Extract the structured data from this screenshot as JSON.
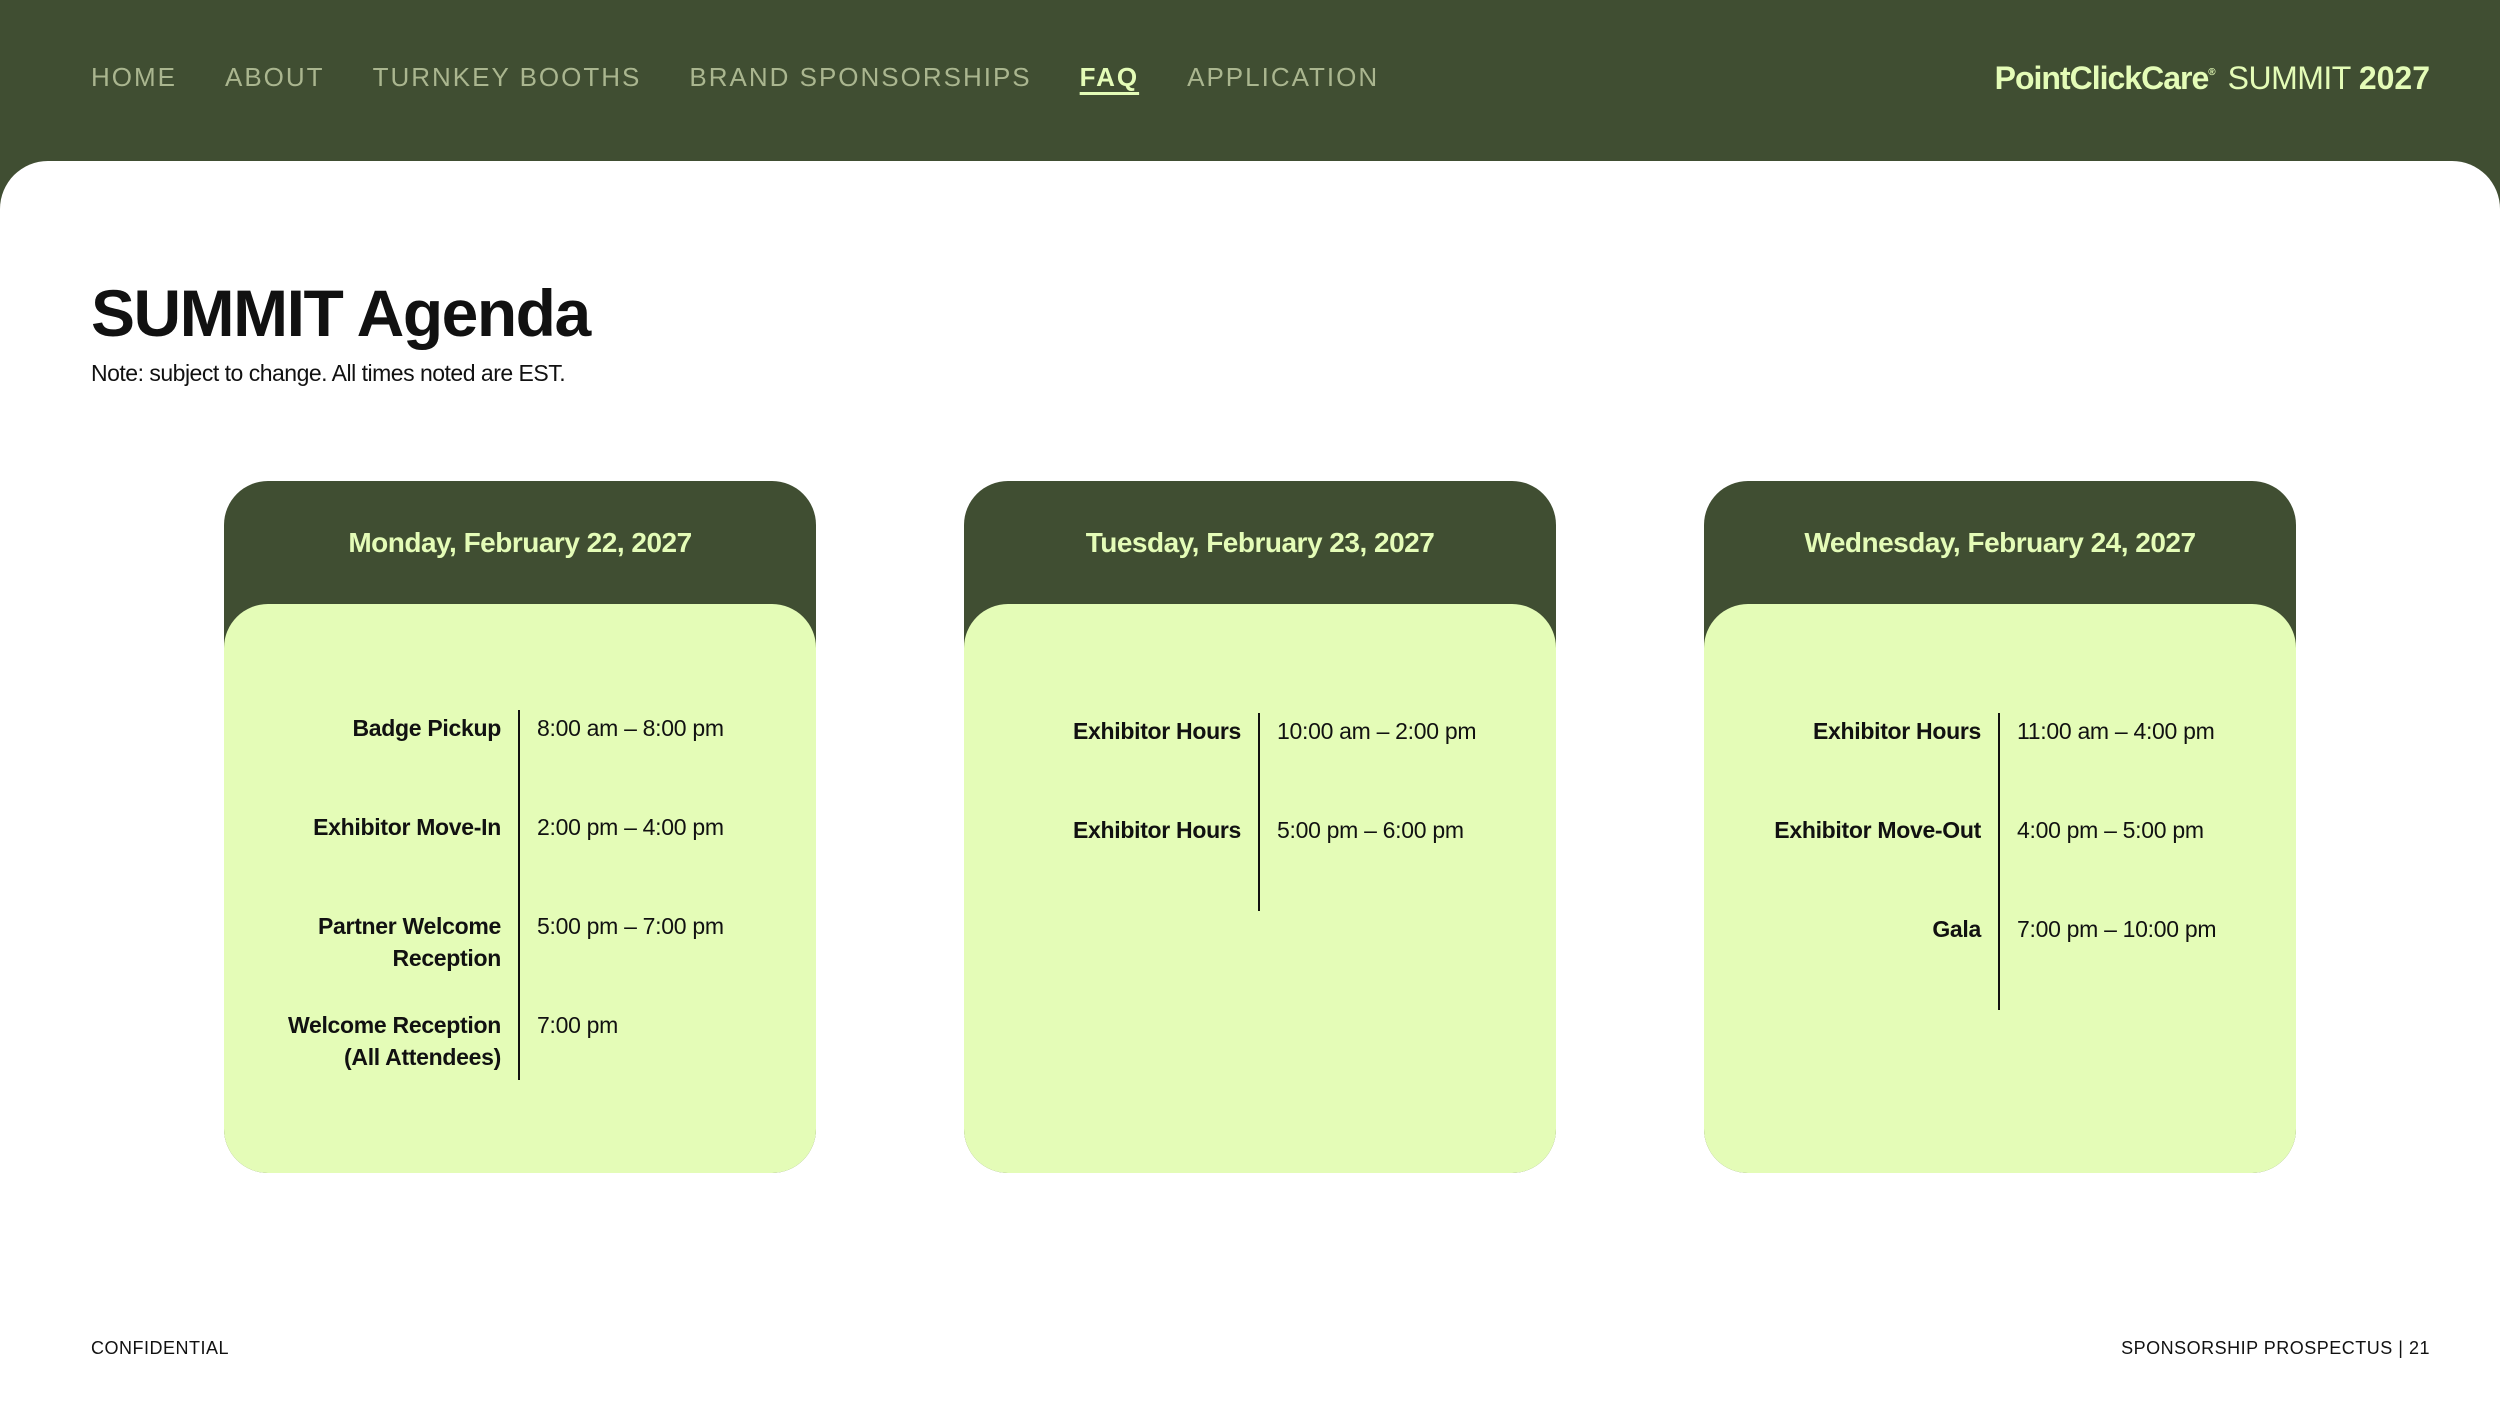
{
  "nav": {
    "items": [
      {
        "label": "HOME",
        "active": false
      },
      {
        "label": "ABOUT",
        "active": false
      },
      {
        "label": "TURNKEY BOOTHS",
        "active": false
      },
      {
        "label": "BRAND SPONSORSHIPS",
        "active": false
      },
      {
        "label": "FAQ",
        "active": true
      },
      {
        "label": "APPLICATION",
        "active": false
      }
    ]
  },
  "brand": {
    "name": "PointClickCare",
    "registered": "®",
    "event": "SUMMIT",
    "year": "2027"
  },
  "page": {
    "title": "SUMMIT Agenda",
    "note": "Note: subject to change. All times noted are EST."
  },
  "days": [
    {
      "date": "Monday, February 22, 2027",
      "rows": [
        {
          "label": "Badge Pickup",
          "time": "8:00 am – 8:00 pm"
        },
        {
          "label": "Exhibitor Move-In",
          "time": "2:00 pm – 4:00 pm"
        },
        {
          "label": "Partner Welcome Reception",
          "time": "5:00 pm – 7:00 pm"
        },
        {
          "label": "Welcome Reception (All Attendees)",
          "time": "7:00 pm"
        }
      ]
    },
    {
      "date": "Tuesday, February 23, 2027",
      "rows": [
        {
          "label": "Exhibitor Hours",
          "time": "10:00 am – 2:00 pm"
        },
        {
          "label": "Exhibitor Hours",
          "time": "5:00 pm – 6:00 pm"
        }
      ]
    },
    {
      "date": "Wednesday, February 24, 2027",
      "rows": [
        {
          "label": "Exhibitor Hours",
          "time": "11:00 am – 4:00 pm"
        },
        {
          "label": "Exhibitor Move-Out",
          "time": "4:00 pm – 5:00 pm"
        },
        {
          "label": "Gala",
          "time": "7:00 pm – 10:00 pm"
        }
      ]
    }
  ],
  "footer": {
    "left": "CONFIDENTIAL",
    "right": "SPONSORSHIP PROSPECTUS | 21"
  },
  "colors": {
    "dark_green": "#404e32",
    "light_green": "#e4fcb7",
    "nav_muted": "#aab68f",
    "text": "#111111",
    "background": "#ffffff"
  }
}
